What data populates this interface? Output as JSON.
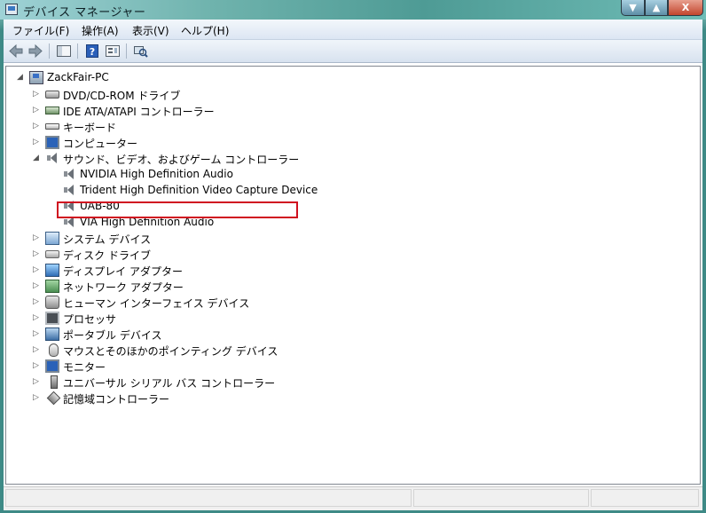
{
  "window": {
    "title": "デバイス マネージャー",
    "controls": {
      "minimize": "▼",
      "maximize": "▲",
      "close": "X"
    }
  },
  "menu": [
    {
      "label": "ファイル(F)"
    },
    {
      "label": "操作(A)"
    },
    {
      "label": "表示(V)"
    },
    {
      "label": "ヘルプ(H)"
    }
  ],
  "toolbar": {
    "buttons": [
      "back-arrow-icon",
      "forward-arrow-icon",
      "show-hide-tree-icon",
      "help-icon",
      "properties-icon",
      "scan-hardware-icon"
    ]
  },
  "tree": {
    "root": {
      "label": "ZackFair-PC",
      "expander": "◢"
    },
    "categories": [
      {
        "label": "DVD/CD-ROM ドライブ",
        "expander": "▷"
      },
      {
        "label": "IDE ATA/ATAPI コントローラー",
        "expander": "▷"
      },
      {
        "label": "キーボード",
        "expander": "▷"
      },
      {
        "label": "コンピューター",
        "expander": "▷"
      },
      {
        "label": "サウンド、ビデオ、およびゲーム コントローラー",
        "expander": "◢"
      },
      {
        "label": "NVIDIA High Definition Audio"
      },
      {
        "label": "Trident High Definition Video Capture Device"
      },
      {
        "label": "UAB-80"
      },
      {
        "label": "VIA High Definition Audio"
      },
      {
        "label": "システム デバイス",
        "expander": "▷"
      },
      {
        "label": "ディスク ドライブ",
        "expander": "▷"
      },
      {
        "label": "ディスプレイ アダプター",
        "expander": "▷"
      },
      {
        "label": "ネットワーク アダプター",
        "expander": "▷"
      },
      {
        "label": "ヒューマン インターフェイス デバイス",
        "expander": "▷"
      },
      {
        "label": "プロセッサ",
        "expander": "▷"
      },
      {
        "label": "ポータブル デバイス",
        "expander": "▷"
      },
      {
        "label": "マウスとそのほかのポインティング デバイス",
        "expander": "▷"
      },
      {
        "label": "モニター",
        "expander": "▷"
      },
      {
        "label": "ユニバーサル シリアル バス コントローラー",
        "expander": "▷"
      },
      {
        "label": "記憶域コントローラー",
        "expander": "▷"
      }
    ]
  },
  "colors": {
    "highlight_border": "#d01020",
    "titlebar": "#6fb3ad"
  }
}
